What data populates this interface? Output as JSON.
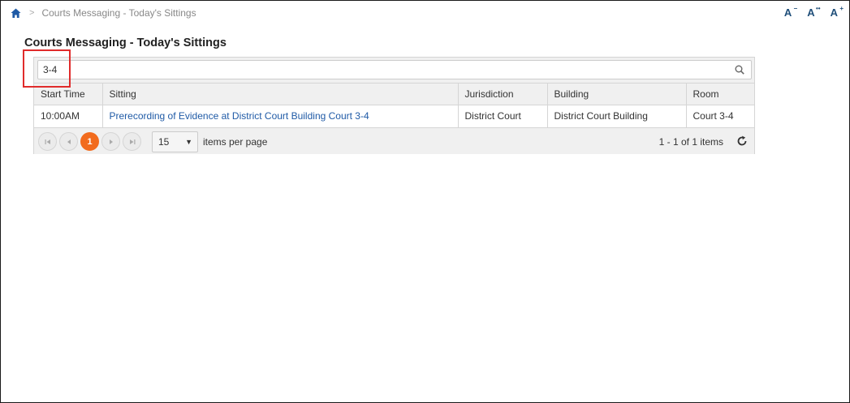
{
  "breadcrumb": {
    "current": "Courts Messaging - Today's Sittings",
    "separator": ">"
  },
  "font_tools": [
    {
      "label": "A",
      "sup": "−",
      "name": "decrease-font-button"
    },
    {
      "label": "A",
      "sup": "••",
      "name": "normal-font-button"
    },
    {
      "label": "A",
      "sup": "+",
      "name": "increase-font-button"
    }
  ],
  "page": {
    "title": "Courts Messaging - Today's Sittings"
  },
  "search": {
    "value": "3-4",
    "icon": "search-icon"
  },
  "table": {
    "headers": [
      "Start Time",
      "Sitting",
      "Jurisdiction",
      "Building",
      "Room"
    ],
    "rows": [
      {
        "start_time": "10:00AM",
        "sitting": "Prerecording of Evidence at District Court Building Court 3-4",
        "jurisdiction": "District Court",
        "building": "District Court Building",
        "room": "Court 3-4"
      }
    ]
  },
  "pager": {
    "current_page": "1",
    "page_size": "15",
    "per_page_label": "items per page",
    "count_label": "1 - 1 of 1 items"
  },
  "colors": {
    "accent": "#f26b1d",
    "link": "#1f5aa6",
    "highlight": "#e02b2b",
    "brand": "#1f4e79"
  }
}
